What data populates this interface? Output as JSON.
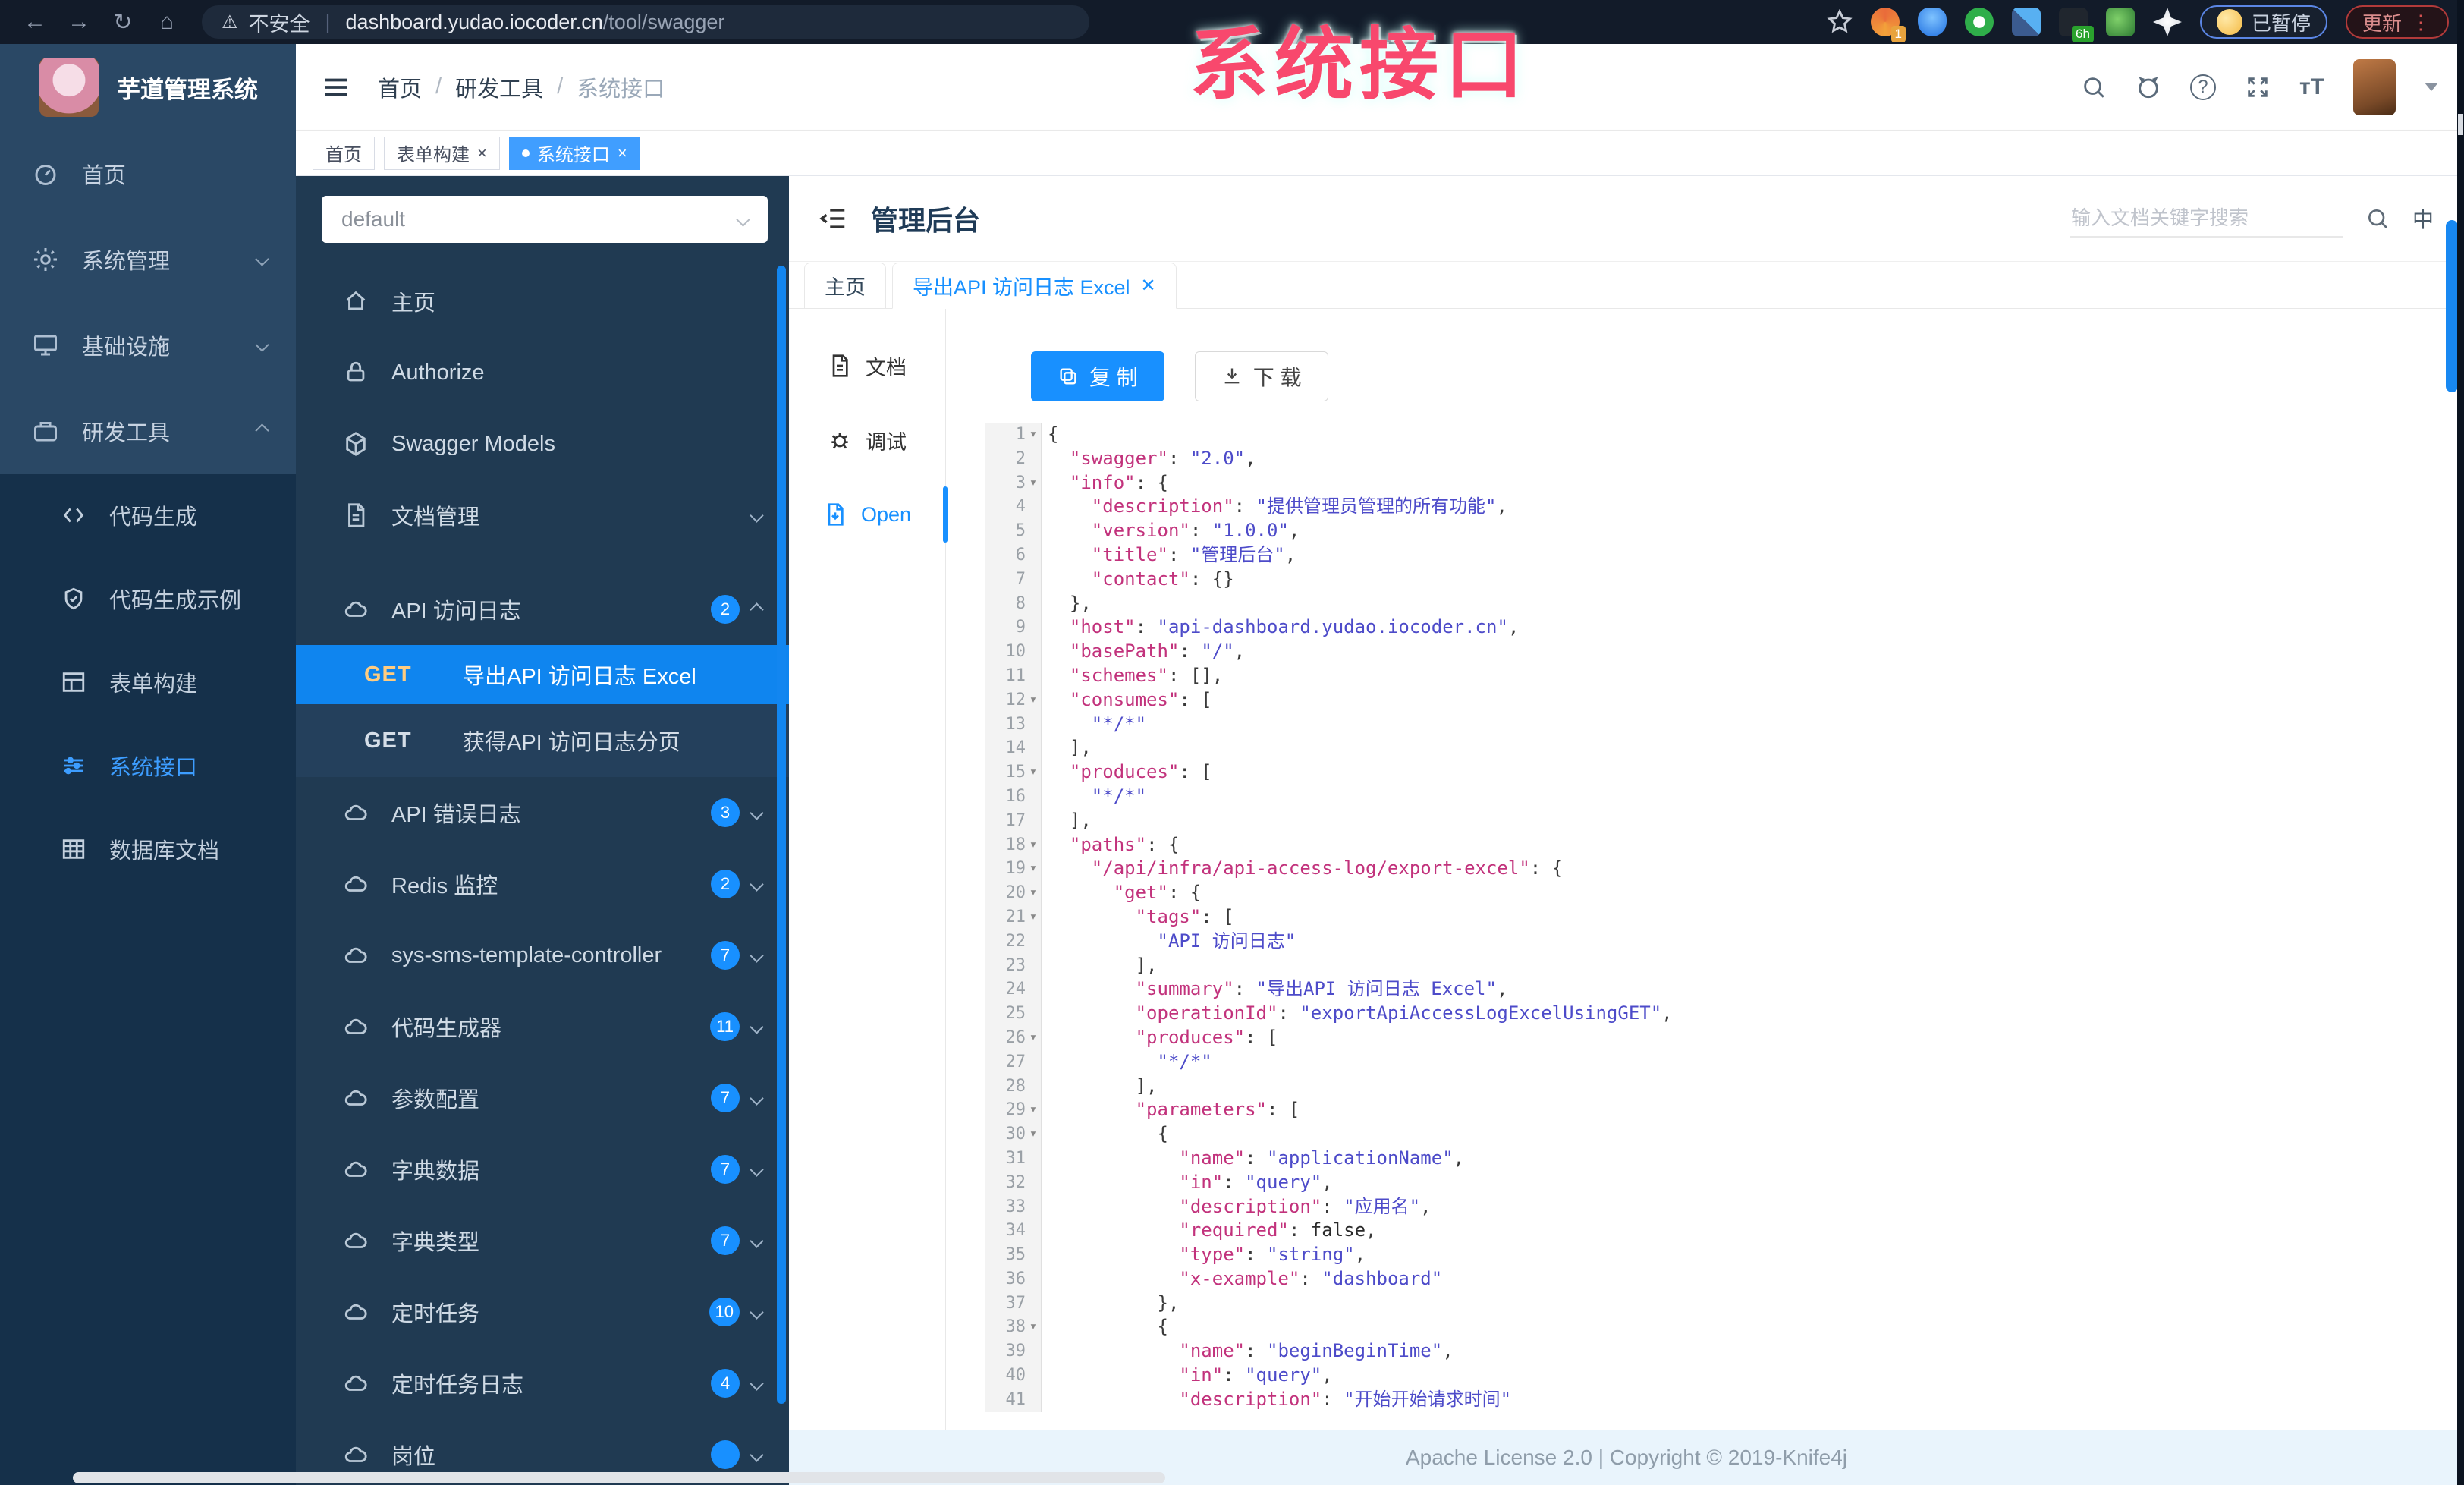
{
  "colors": {
    "accent": "#1890ff",
    "sidebar_active": "#409eff",
    "watermark_pink": "#f8486d",
    "selected_op_bg": "#0f85ef"
  },
  "browser": {
    "security_label": "不安全",
    "url_domain": "dashboard.yudao.iocoder.cn",
    "url_path": "/tool/swagger",
    "ext_badge_1": "1",
    "ext_badge_6h": "6h",
    "paused_label": "已暂停",
    "update_label": "更新",
    "menu_dots": "⋮"
  },
  "watermark": "系统接口",
  "logo": {
    "title": "芋道管理系统"
  },
  "breadcrumb": {
    "separator": "/",
    "items": [
      "首页",
      "研发工具",
      "系统接口"
    ]
  },
  "tag_tabs": [
    {
      "label": "首页",
      "closable": false,
      "active": false
    },
    {
      "label": "表单构建",
      "closable": true,
      "active": false
    },
    {
      "label": "系统接口",
      "closable": true,
      "active": true
    }
  ],
  "sidebar": {
    "top_items": [
      {
        "label": "首页",
        "icon": "dashboard-icon",
        "chevron": null
      },
      {
        "label": "系统管理",
        "icon": "gear-icon",
        "chevron": "down"
      },
      {
        "label": "基础设施",
        "icon": "monitor-icon",
        "chevron": "down"
      },
      {
        "label": "研发工具",
        "icon": "briefcase-icon",
        "chevron": "up"
      }
    ],
    "sub_items": [
      {
        "label": "代码生成",
        "icon": "code-icon",
        "active": false
      },
      {
        "label": "代码生成示例",
        "icon": "shield-icon",
        "active": false
      },
      {
        "label": "表单构建",
        "icon": "form-icon",
        "active": false
      },
      {
        "label": "系统接口",
        "icon": "sliders-icon",
        "active": true
      },
      {
        "label": "数据库文档",
        "icon": "table-icon",
        "active": false
      }
    ]
  },
  "swagger_sidebar": {
    "select_value": "default",
    "items": [
      {
        "type": "link",
        "label": "主页",
        "icon": "home-icon"
      },
      {
        "type": "link",
        "label": "Authorize",
        "icon": "lock-icon"
      },
      {
        "type": "link",
        "label": "Swagger Models",
        "icon": "cube-icon"
      },
      {
        "type": "group",
        "label": "文档管理",
        "icon": "file-icon",
        "badge": null,
        "chevron": "down"
      },
      {
        "type": "group",
        "label": "API 访问日志",
        "icon": "cloud-icon",
        "badge": "2",
        "chevron": "up"
      },
      {
        "type": "op",
        "method": "GET",
        "label": "导出API 访问日志 Excel",
        "active": true
      },
      {
        "type": "op",
        "method": "GET",
        "label": "获得API 访问日志分页",
        "active": false
      },
      {
        "type": "group",
        "label": "API 错误日志",
        "icon": "cloud-icon",
        "badge": "3",
        "chevron": "down"
      },
      {
        "type": "group",
        "label": "Redis 监控",
        "icon": "cloud-icon",
        "badge": "2",
        "chevron": "down"
      },
      {
        "type": "group",
        "label": "sys-sms-template-controller",
        "icon": "cloud-icon",
        "badge": "7",
        "chevron": "down"
      },
      {
        "type": "group",
        "label": "代码生成器",
        "icon": "cloud-icon",
        "badge": "11",
        "chevron": "down"
      },
      {
        "type": "group",
        "label": "参数配置",
        "icon": "cloud-icon",
        "badge": "7",
        "chevron": "down"
      },
      {
        "type": "group",
        "label": "字典数据",
        "icon": "cloud-icon",
        "badge": "7",
        "chevron": "down"
      },
      {
        "type": "group",
        "label": "字典类型",
        "icon": "cloud-icon",
        "badge": "7",
        "chevron": "down"
      },
      {
        "type": "group",
        "label": "定时任务",
        "icon": "cloud-icon",
        "badge": "10",
        "chevron": "down"
      },
      {
        "type": "group",
        "label": "定时任务日志",
        "icon": "cloud-icon",
        "badge": "4",
        "chevron": "down"
      },
      {
        "type": "group",
        "label": "岗位",
        "icon": "cloud-icon",
        "badge": "",
        "chevron": "down"
      }
    ]
  },
  "panel": {
    "title": "管理后台",
    "search_placeholder": "输入文档关键字搜索",
    "lang_icon": "中",
    "tabs": [
      {
        "label": "主页",
        "closable": false,
        "active": false
      },
      {
        "label": "导出API 访问日志 Excel",
        "closable": true,
        "active": true
      }
    ],
    "mini_nav": [
      {
        "label": "文档",
        "icon": "doc-icon",
        "active": false
      },
      {
        "label": "调试",
        "icon": "bug-icon",
        "active": false
      },
      {
        "label": "Open",
        "icon": "open-file-icon",
        "active": true
      }
    ],
    "copy_label": "复 制",
    "download_label": "下 载",
    "footer": "Apache License 2.0 | Copyright © 2019-Knife4j"
  },
  "editor": {
    "lines": [
      {
        "n": 1,
        "fold": true,
        "seg": [
          [
            "p",
            "{"
          ]
        ]
      },
      {
        "n": 2,
        "fold": false,
        "seg": [
          [
            "p",
            "  "
          ],
          [
            "k",
            "\"swagger\""
          ],
          [
            "p",
            ": "
          ],
          [
            "v",
            "\"2.0\""
          ],
          [
            "p",
            ","
          ]
        ]
      },
      {
        "n": 3,
        "fold": true,
        "seg": [
          [
            "p",
            "  "
          ],
          [
            "k",
            "\"info\""
          ],
          [
            "p",
            ": {"
          ]
        ]
      },
      {
        "n": 4,
        "fold": false,
        "seg": [
          [
            "p",
            "    "
          ],
          [
            "k",
            "\"description\""
          ],
          [
            "p",
            ": "
          ],
          [
            "v",
            "\"提供管理员管理的所有功能\""
          ],
          [
            "p",
            ","
          ]
        ]
      },
      {
        "n": 5,
        "fold": false,
        "seg": [
          [
            "p",
            "    "
          ],
          [
            "k",
            "\"version\""
          ],
          [
            "p",
            ": "
          ],
          [
            "v",
            "\"1.0.0\""
          ],
          [
            "p",
            ","
          ]
        ]
      },
      {
        "n": 6,
        "fold": false,
        "seg": [
          [
            "p",
            "    "
          ],
          [
            "k",
            "\"title\""
          ],
          [
            "p",
            ": "
          ],
          [
            "v",
            "\"管理后台\""
          ],
          [
            "p",
            ","
          ]
        ]
      },
      {
        "n": 7,
        "fold": false,
        "seg": [
          [
            "p",
            "    "
          ],
          [
            "k",
            "\"contact\""
          ],
          [
            "p",
            ": {}"
          ]
        ]
      },
      {
        "n": 8,
        "fold": false,
        "seg": [
          [
            "p",
            "  },"
          ]
        ]
      },
      {
        "n": 9,
        "fold": false,
        "seg": [
          [
            "p",
            "  "
          ],
          [
            "k",
            "\"host\""
          ],
          [
            "p",
            ": "
          ],
          [
            "v",
            "\"api-dashboard.yudao.iocoder.cn\""
          ],
          [
            "p",
            ","
          ]
        ]
      },
      {
        "n": 10,
        "fold": false,
        "seg": [
          [
            "p",
            "  "
          ],
          [
            "k",
            "\"basePath\""
          ],
          [
            "p",
            ": "
          ],
          [
            "v",
            "\"/\""
          ],
          [
            "p",
            ","
          ]
        ]
      },
      {
        "n": 11,
        "fold": false,
        "seg": [
          [
            "p",
            "  "
          ],
          [
            "k",
            "\"schemes\""
          ],
          [
            "p",
            ": [],"
          ]
        ]
      },
      {
        "n": 12,
        "fold": true,
        "seg": [
          [
            "p",
            "  "
          ],
          [
            "k",
            "\"consumes\""
          ],
          [
            "p",
            ": ["
          ]
        ]
      },
      {
        "n": 13,
        "fold": false,
        "seg": [
          [
            "p",
            "    "
          ],
          [
            "v",
            "\"*/*\""
          ]
        ]
      },
      {
        "n": 14,
        "fold": false,
        "seg": [
          [
            "p",
            "  ],"
          ]
        ]
      },
      {
        "n": 15,
        "fold": true,
        "seg": [
          [
            "p",
            "  "
          ],
          [
            "k",
            "\"produces\""
          ],
          [
            "p",
            ": ["
          ]
        ]
      },
      {
        "n": 16,
        "fold": false,
        "seg": [
          [
            "p",
            "    "
          ],
          [
            "v",
            "\"*/*\""
          ]
        ]
      },
      {
        "n": 17,
        "fold": false,
        "seg": [
          [
            "p",
            "  ],"
          ]
        ]
      },
      {
        "n": 18,
        "fold": true,
        "seg": [
          [
            "p",
            "  "
          ],
          [
            "k",
            "\"paths\""
          ],
          [
            "p",
            ": {"
          ]
        ]
      },
      {
        "n": 19,
        "fold": true,
        "seg": [
          [
            "p",
            "    "
          ],
          [
            "k",
            "\"/api/infra/api-access-log/export-excel\""
          ],
          [
            "p",
            ": {"
          ]
        ]
      },
      {
        "n": 20,
        "fold": true,
        "seg": [
          [
            "p",
            "      "
          ],
          [
            "k",
            "\"get\""
          ],
          [
            "p",
            ": {"
          ]
        ]
      },
      {
        "n": 21,
        "fold": true,
        "seg": [
          [
            "p",
            "        "
          ],
          [
            "k",
            "\"tags\""
          ],
          [
            "p",
            ": ["
          ]
        ]
      },
      {
        "n": 22,
        "fold": false,
        "seg": [
          [
            "p",
            "          "
          ],
          [
            "v",
            "\"API 访问日志\""
          ]
        ]
      },
      {
        "n": 23,
        "fold": false,
        "seg": [
          [
            "p",
            "        ],"
          ]
        ]
      },
      {
        "n": 24,
        "fold": false,
        "seg": [
          [
            "p",
            "        "
          ],
          [
            "k",
            "\"summary\""
          ],
          [
            "p",
            ": "
          ],
          [
            "v",
            "\"导出API 访问日志 Excel\""
          ],
          [
            "p",
            ","
          ]
        ]
      },
      {
        "n": 25,
        "fold": false,
        "seg": [
          [
            "p",
            "        "
          ],
          [
            "k",
            "\"operationId\""
          ],
          [
            "p",
            ": "
          ],
          [
            "v",
            "\"exportApiAccessLogExcelUsingGET\""
          ],
          [
            "p",
            ","
          ]
        ]
      },
      {
        "n": 26,
        "fold": true,
        "seg": [
          [
            "p",
            "        "
          ],
          [
            "k",
            "\"produces\""
          ],
          [
            "p",
            ": ["
          ]
        ]
      },
      {
        "n": 27,
        "fold": false,
        "seg": [
          [
            "p",
            "          "
          ],
          [
            "v",
            "\"*/*\""
          ]
        ]
      },
      {
        "n": 28,
        "fold": false,
        "seg": [
          [
            "p",
            "        ],"
          ]
        ]
      },
      {
        "n": 29,
        "fold": true,
        "seg": [
          [
            "p",
            "        "
          ],
          [
            "k",
            "\"parameters\""
          ],
          [
            "p",
            ": ["
          ]
        ]
      },
      {
        "n": 30,
        "fold": true,
        "seg": [
          [
            "p",
            "          {"
          ]
        ]
      },
      {
        "n": 31,
        "fold": false,
        "seg": [
          [
            "p",
            "            "
          ],
          [
            "k",
            "\"name\""
          ],
          [
            "p",
            ": "
          ],
          [
            "v",
            "\"applicationName\""
          ],
          [
            "p",
            ","
          ]
        ]
      },
      {
        "n": 32,
        "fold": false,
        "seg": [
          [
            "p",
            "            "
          ],
          [
            "k",
            "\"in\""
          ],
          [
            "p",
            ": "
          ],
          [
            "v",
            "\"query\""
          ],
          [
            "p",
            ","
          ]
        ]
      },
      {
        "n": 33,
        "fold": false,
        "seg": [
          [
            "p",
            "            "
          ],
          [
            "k",
            "\"description\""
          ],
          [
            "p",
            ": "
          ],
          [
            "v",
            "\"应用名\""
          ],
          [
            "p",
            ","
          ]
        ]
      },
      {
        "n": 34,
        "fold": false,
        "seg": [
          [
            "p",
            "            "
          ],
          [
            "k",
            "\"required\""
          ],
          [
            "p",
            ": "
          ],
          [
            "b",
            "false"
          ],
          [
            "p",
            ","
          ]
        ]
      },
      {
        "n": 35,
        "fold": false,
        "seg": [
          [
            "p",
            "            "
          ],
          [
            "k",
            "\"type\""
          ],
          [
            "p",
            ": "
          ],
          [
            "v",
            "\"string\""
          ],
          [
            "p",
            ","
          ]
        ]
      },
      {
        "n": 36,
        "fold": false,
        "seg": [
          [
            "p",
            "            "
          ],
          [
            "k",
            "\"x-example\""
          ],
          [
            "p",
            ": "
          ],
          [
            "v",
            "\"dashboard\""
          ]
        ]
      },
      {
        "n": 37,
        "fold": false,
        "seg": [
          [
            "p",
            "          },"
          ]
        ]
      },
      {
        "n": 38,
        "fold": true,
        "seg": [
          [
            "p",
            "          {"
          ]
        ]
      },
      {
        "n": 39,
        "fold": false,
        "seg": [
          [
            "p",
            "            "
          ],
          [
            "k",
            "\"name\""
          ],
          [
            "p",
            ": "
          ],
          [
            "v",
            "\"beginBeginTime\""
          ],
          [
            "p",
            ","
          ]
        ]
      },
      {
        "n": 40,
        "fold": false,
        "seg": [
          [
            "p",
            "            "
          ],
          [
            "k",
            "\"in\""
          ],
          [
            "p",
            ": "
          ],
          [
            "v",
            "\"query\""
          ],
          [
            "p",
            ","
          ]
        ]
      },
      {
        "n": 41,
        "fold": false,
        "seg": [
          [
            "p",
            "            "
          ],
          [
            "k",
            "\"description\""
          ],
          [
            "p",
            ": "
          ],
          [
            "v",
            "\"开始开始请求时间\""
          ]
        ]
      }
    ]
  }
}
